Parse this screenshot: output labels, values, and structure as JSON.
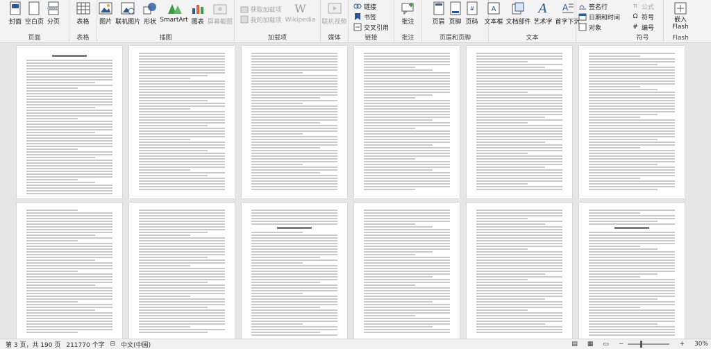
{
  "ribbon": {
    "groups": {
      "pages": {
        "label": "页面",
        "cover": "封面",
        "blank": "空白页",
        "break": "分页"
      },
      "table": {
        "label": "表格",
        "table": "表格"
      },
      "illustrations": {
        "label": "插图",
        "picture": "图片",
        "online_picture": "联机图片",
        "shapes": "形状",
        "smartart": "SmartArt",
        "chart": "图表",
        "screenshot": "屏幕截图"
      },
      "addins": {
        "label": "加载项",
        "get": "获取加载项",
        "my": "我的加载项",
        "wikipedia": "Wikipedia"
      },
      "media": {
        "label": "媒体",
        "online_video": "联机视频"
      },
      "links": {
        "label": "链接",
        "link": "链接",
        "bookmark": "书签",
        "cross_ref": "交叉引用"
      },
      "comments": {
        "label": "批注",
        "comment": "批注"
      },
      "header_footer": {
        "label": "页眉和页脚",
        "header": "页眉",
        "footer": "页脚",
        "page_number": "页码"
      },
      "text": {
        "label": "文本",
        "textbox": "文本框",
        "quick_parts": "文档部件",
        "wordart": "艺术字",
        "dropcap": "首字下沉"
      },
      "symbols_text": {
        "signature": "签名行",
        "datetime": "日期和时间",
        "object": "对象"
      },
      "symbols": {
        "label": "符号",
        "equation": "公式",
        "symbol": "符号",
        "number": "编号"
      },
      "flash": {
        "label": "Flash",
        "embed": "嵌入\nFlash"
      }
    }
  },
  "status": {
    "page": "第 3 页，共 190 页",
    "words": "211770 个字",
    "lang": "中文(中国)",
    "zoom": "30%"
  },
  "colors": {
    "accent": "#2b579a",
    "ribbon_bg": "#f3f3f3",
    "canvas_bg": "#e6e6e6"
  }
}
